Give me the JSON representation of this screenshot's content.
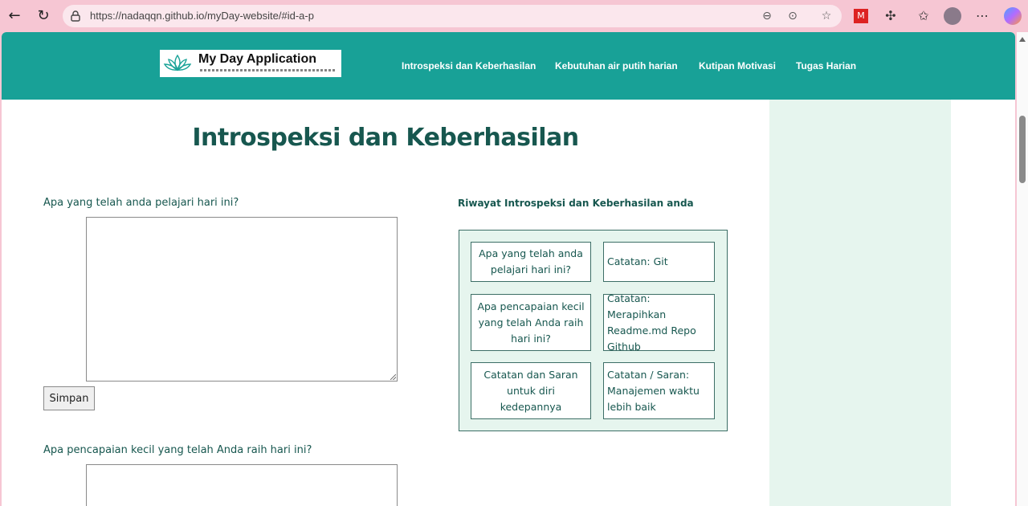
{
  "browser": {
    "url": "https://nadaqqn.github.io/myDay-website/#id-a-p"
  },
  "site": {
    "logo_title": "My Day Application",
    "nav": [
      "Introspeksi dan Keberhasilan",
      "Kebutuhan air putih harian",
      "Kutipan Motivasi",
      "Tugas Harian"
    ]
  },
  "main": {
    "title": "Introspeksi dan Keberhasilan",
    "question1": "Apa yang telah anda pelajari hari ini?",
    "question1_value": "",
    "save_label": "Simpan",
    "question2": "Apa pencapaian kecil yang telah Anda raih hari ini?",
    "question2_value": ""
  },
  "history": {
    "title": "Riwayat Introspeksi dan Keberhasilan anda",
    "rows": [
      {
        "q": "Apa yang telah anda pelajari hari ini?",
        "a": "Catatan: Git"
      },
      {
        "q": "Apa pencapaian kecil yang telah Anda raih hari ini?",
        "a": "Catatan: Merapihkan Readme.md Repo Github"
      },
      {
        "q": "Catatan dan Saran untuk diri kedepannya",
        "a": "Catatan / Saran: Manajemen waktu lebih baik"
      }
    ]
  },
  "colors": {
    "header_bg": "#18a197",
    "accent_text": "#17574f",
    "side_panel_bg": "#e6f5ee",
    "browser_frame": "#f6c6d3"
  }
}
